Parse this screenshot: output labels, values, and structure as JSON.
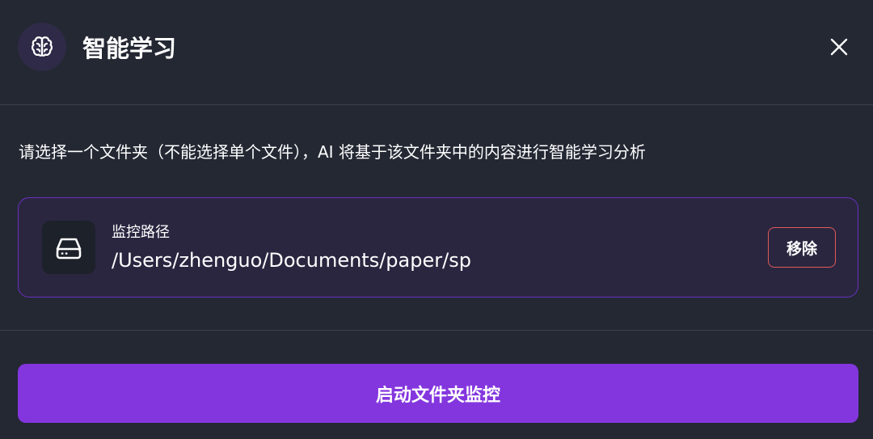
{
  "header": {
    "title": "智能学习",
    "icon": "brain-icon",
    "close_icon": "close-icon"
  },
  "description": "请选择一个文件夹（不能选择单个文件），AI 将基于该文件夹中的内容进行智能学习分析",
  "monitor": {
    "icon": "hard-drive-icon",
    "label": "监控路径",
    "path": "/Users/zhenguo/Documents/paper/sp",
    "remove_label": "移除"
  },
  "start_button_label": "启动文件夹监控",
  "colors": {
    "background": "#232833",
    "accent": "#8436de",
    "card_border": "#6a2fbf",
    "danger": "#e05a5a"
  }
}
